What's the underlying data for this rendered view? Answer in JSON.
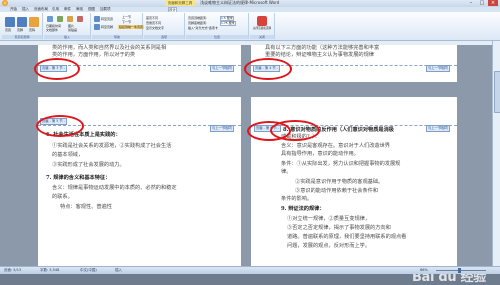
{
  "titlebar": {
    "title": "浅谈唯物主义辩证法的规律-Microsoft Word",
    "context_tab": "页眉和页脚工具",
    "minimize": "–",
    "maximize": "□",
    "close": "×"
  },
  "ribbon_tabs": [
    "开始",
    "插入",
    "页面布局",
    "引用",
    "邮件",
    "审阅",
    "视图",
    "加载项",
    "设计"
  ],
  "ribbon": {
    "groups": [
      {
        "label": "页眉和页脚",
        "items": [
          "页眉",
          "页脚",
          "页码"
        ]
      },
      {
        "label": "插入",
        "items": [
          "日期和时间",
          "文档部件",
          "图片",
          "剪贴画"
        ]
      },
      {
        "label": "导航",
        "items": [
          "转至页眉",
          "转至页脚",
          "上一节",
          "下一节",
          "链接到前一条页眉"
        ]
      },
      {
        "label": "选项",
        "items": [
          "首页不同",
          "奇偶页不同",
          "显示文档文字"
        ]
      },
      {
        "label": "位置",
        "items": [
          "页眉顶端距离:",
          "页脚底端距离:",
          "插入\"对齐方式\"选项卡"
        ]
      },
      {
        "label": "关闭",
        "items": [
          "关闭页眉和页脚"
        ]
      }
    ],
    "header_distance": "1.5 厘米",
    "footer_distance": "1.75 厘米"
  },
  "pages": {
    "top_left": {
      "text": "类的作用，而人类和自然界以及社会的关系则是相",
      "text2": "类的作用，方面作用，所以对于的类",
      "header_tag": "页眉 - 第 3 节 -",
      "link_tag": "与上一节相同"
    },
    "top_right": {
      "text": "具有以下三方面的功能（这种方法能够完善和丰富",
      "text2": "重要的结论，辩证唯物主义认为事物发展的规律",
      "header_tag": "页眉 - 第 4 节 -",
      "link_tag": "与上一节相同"
    },
    "bottom_left": {
      "header_tag": "页眉 - 第 5 节 -",
      "link_tag": "与上一节相同",
      "lines": [
        "6. 社会生活在本质上是实践的：",
        "①实践是社会关系的发源地，②实践构成了社会生活",
        "的基本领域，",
        "③实践形成了社会发展的动力。",
        "7. 规律的含义和基本特征：",
        "含义：规律是事物运动发展中的本质的、必然的和稳定",
        "的联系。",
        "特点：客观性、普遍性"
      ]
    },
    "bottom_right": {
      "header_tag": "页眉 - 第 6 节 -",
      "link_tag": "与上一节相同",
      "lines": [
        "8. 意识对物质的反作用（人们意识对物质是消极",
        "或是积极的？）：",
        "含义：意识是客观存在。意识对于人们改造世界",
        "具有指导作用，意识的能动作用。",
        "条件：①从实际出发，努力认识和把握事物的发展规",
        "律。",
        "②实践是意识作用于物质的客观基础。",
        "③意识的能动作用依赖于社会条件和",
        "条件的影响。",
        "9. 辩证法的规律：",
        "①对立统一规律，②质量互变规律，",
        "③否定之否定规律，揭示了事物发展的方向和",
        "道路。普遍联系的原理，我们要坚持用联系的观点看",
        "问题，发展的观点，反对形而上学。"
      ]
    }
  },
  "statusbar": {
    "page": "页面: 5/13",
    "words": "字数: 3,548",
    "lang": "中文(中国)",
    "mode": "插入",
    "zoom": "66%"
  },
  "watermark": "Bai du 经验",
  "accent_red": "#e0161b"
}
